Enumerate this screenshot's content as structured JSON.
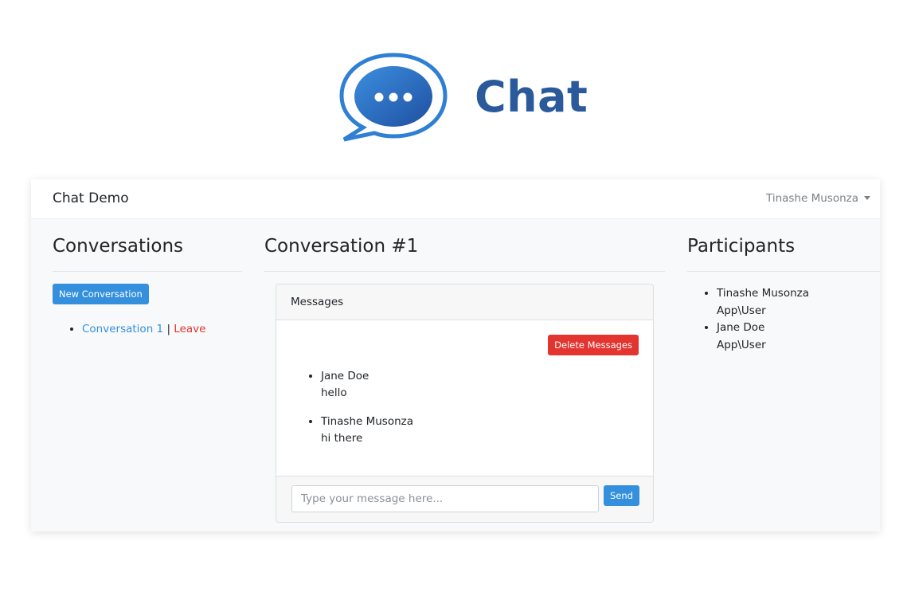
{
  "logo": {
    "text": "Chat"
  },
  "navbar": {
    "brand": "Chat Demo",
    "user": "Tinashe Musonza"
  },
  "conversations": {
    "title": "Conversations",
    "new_button": "New Conversation",
    "items": [
      {
        "name": "Conversation 1",
        "separator": "|",
        "leave": "Leave"
      }
    ]
  },
  "conversation": {
    "title": "Conversation #1",
    "card_header": "Messages",
    "delete_button": "Delete Messages",
    "messages": [
      {
        "sender": "Jane Doe",
        "text": "hello"
      },
      {
        "sender": "Tinashe Musonza",
        "text": "hi there"
      }
    ],
    "input_placeholder": "Type your message here...",
    "send_button": "Send"
  },
  "participants": {
    "title": "Participants",
    "items": [
      {
        "name": "Tinashe Musonza",
        "type": "App\\User"
      },
      {
        "name": "Jane Doe",
        "type": "App\\User"
      }
    ]
  },
  "colors": {
    "primary": "#3490dc",
    "danger": "#e3342f",
    "logo_blue": "#2a5a9c"
  }
}
